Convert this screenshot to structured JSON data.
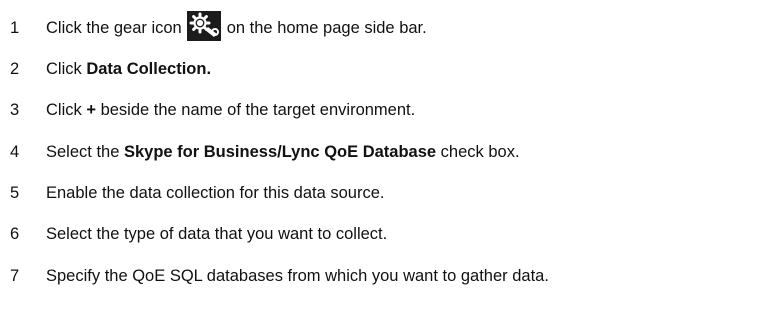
{
  "steps": [
    {
      "num": "1",
      "pre": "Click the gear icon",
      "post": "on the home page side bar.",
      "icon": "gear-icon"
    },
    {
      "num": "2",
      "pre": "Click ",
      "bold": "Data Collection."
    },
    {
      "num": "3",
      "pre": "Click ",
      "bold": "+",
      "post": " beside the name of the target environment."
    },
    {
      "num": "4",
      "pre": "Select the ",
      "bold": "Skype for Business/Lync QoE Database",
      "post": " check box."
    },
    {
      "num": "5",
      "pre": "Enable the data collection for this data source."
    },
    {
      "num": "6",
      "pre": "Select the type of data that you want to collect."
    },
    {
      "num": "7",
      "pre": "Specify the QoE SQL databases from which you want to gather data."
    }
  ]
}
